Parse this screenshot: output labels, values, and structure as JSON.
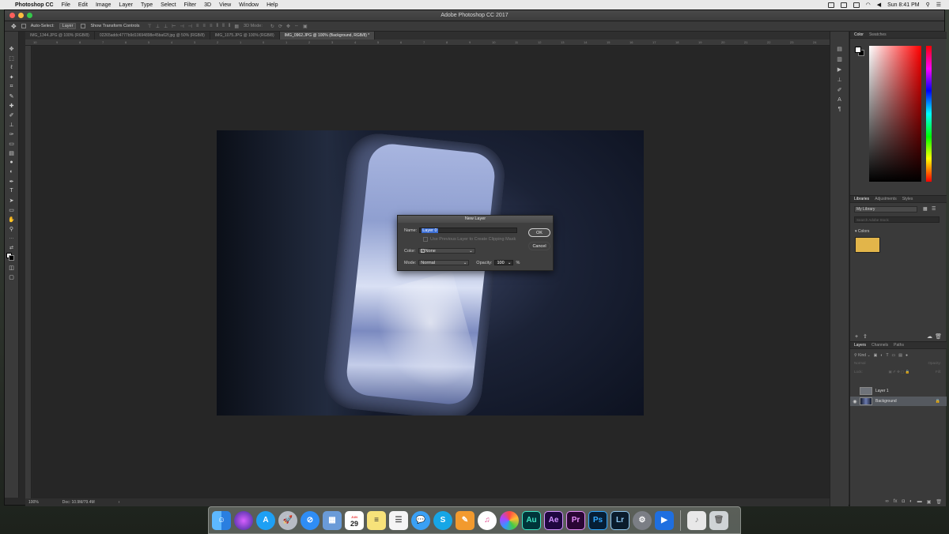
{
  "menubar": {
    "apple": "",
    "app_name": "Photoshop CC",
    "items": [
      "File",
      "Edit",
      "Image",
      "Layer",
      "Type",
      "Select",
      "Filter",
      "3D",
      "View",
      "Window",
      "Help"
    ],
    "clock": "Sun 8:41 PM"
  },
  "window": {
    "title": "Adobe Photoshop CC 2017"
  },
  "options": {
    "auto_select_label": "Auto-Select:",
    "auto_select_value": "Layer",
    "transform_label": "Show Transform Controls",
    "mode_3d": "3D Mode:"
  },
  "tabs": [
    {
      "label": "IMG_1344.JPG @ 100% (RGB/8)"
    },
    {
      "label": "02265addc4777b9d10694898e45ba62f.jpg @ 50% (RGB/8)"
    },
    {
      "label": "IMG_1075.JPG @ 100% (RGB/8)"
    },
    {
      "label": "IMG_0962.JPG @ 100% (Background, RGB/8) *"
    }
  ],
  "ruler_ticks": [
    "10",
    "9",
    "8",
    "7",
    "6",
    "5",
    "4",
    "3",
    "2",
    "1",
    "0",
    "1",
    "2",
    "3",
    "4",
    "5",
    "6",
    "7",
    "8",
    "9",
    "10",
    "11",
    "12",
    "13",
    "14",
    "15",
    "16",
    "17",
    "18",
    "19",
    "20",
    "21",
    "22",
    "23",
    "24"
  ],
  "status": {
    "zoom": "100%",
    "doc": "Doc: 10.9M/79.4M"
  },
  "dialog": {
    "title": "New Layer",
    "name_label": "Name:",
    "name_value": "Layer 0",
    "clip_label": "Use Previous Layer to Create Clipping Mask",
    "color_label": "Color:",
    "color_value": "None",
    "mode_label": "Mode:",
    "mode_value": "Normal",
    "opacity_label": "Opacity:",
    "opacity_value": "100",
    "percent": "%",
    "ok_label": "OK",
    "cancel_label": "Cancel"
  },
  "panels": {
    "color_tabs": [
      "Color",
      "Swatches"
    ],
    "lib_tabs": [
      "Libraries",
      "Adjustments",
      "Styles"
    ],
    "library_name": "My Library",
    "lib_search": "Search Adobe Stock",
    "colors_label": "Colors",
    "swatch_color": "#e2b54a",
    "layers_tabs": [
      "Layers",
      "Channels",
      "Paths"
    ],
    "kind_label": "Kind",
    "blend_mode": "Normal",
    "opacity_label": "Opacity:",
    "lock_label": "Lock:",
    "fill_label": "Fill:",
    "layers": [
      {
        "name": "Layer 1",
        "visible": false
      },
      {
        "name": "Background",
        "visible": true
      }
    ]
  },
  "dock": {
    "apps": [
      "Finder",
      "Siri",
      "App Store",
      "Launchpad",
      "Safari",
      "Preview",
      "Calendar",
      "Notes",
      "Reminders",
      "Messages",
      "Skype",
      "Pages",
      "iTunes",
      "Photos",
      "Au",
      "Ae",
      "Pr",
      "Ps",
      "Lr",
      "System Preferences",
      "Screenium",
      "Music",
      "Trash"
    ],
    "calendar_day": "29",
    "calendar_month": "JUN"
  }
}
